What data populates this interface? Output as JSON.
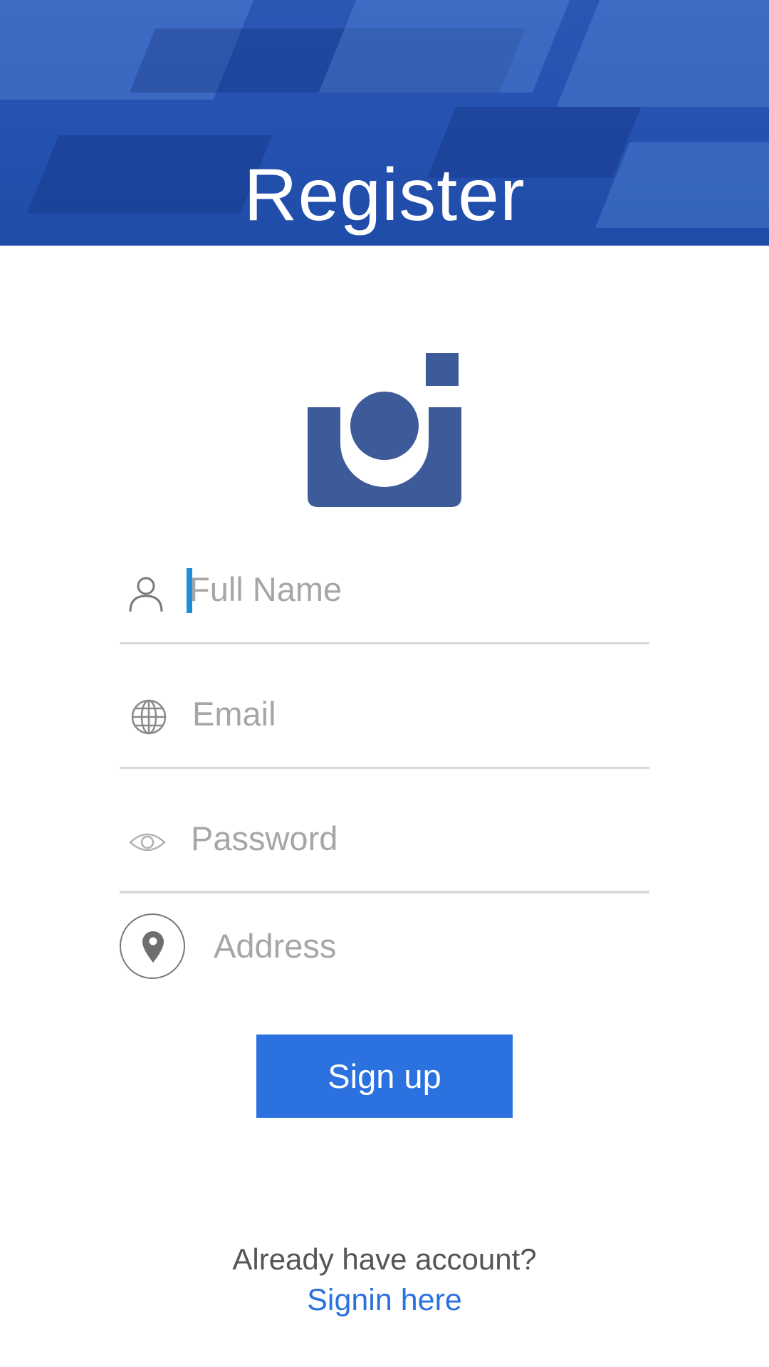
{
  "header": {
    "title": "Register"
  },
  "form": {
    "full_name": {
      "placeholder": "Full Name",
      "value": ""
    },
    "email": {
      "placeholder": "Email",
      "value": ""
    },
    "password": {
      "placeholder": "Password",
      "value": ""
    },
    "address": {
      "placeholder": "Address",
      "value": ""
    }
  },
  "signup_button": {
    "label": "Sign up"
  },
  "footer": {
    "prompt": "Already have account?",
    "signin_link": "Signin here"
  },
  "icons": {
    "logo": "camera-logo-icon",
    "full_name": "person-icon",
    "email": "globe-icon",
    "password": "eye-icon",
    "address": "map-pin-icon"
  },
  "colors": {
    "header_bg": "#2551b0",
    "logo": "#3d5a99",
    "primary_button": "#2b72e0",
    "link": "#2b72e0",
    "caret": "#1a8fd8",
    "placeholder": "#a6a6a6",
    "divider": "#d9d9d9"
  }
}
